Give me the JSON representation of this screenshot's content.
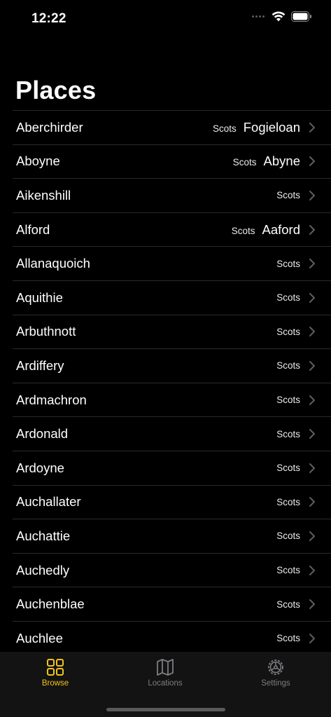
{
  "status_bar": {
    "time": "12:22"
  },
  "title": "Places",
  "places": [
    {
      "name": "Aberchirder",
      "lang": "Scots",
      "translation": "Fogieloan"
    },
    {
      "name": "Aboyne",
      "lang": "Scots",
      "translation": "Abyne"
    },
    {
      "name": "Aikenshill",
      "lang": "Scots",
      "translation": ""
    },
    {
      "name": "Alford",
      "lang": "Scots",
      "translation": "Aaford"
    },
    {
      "name": "Allanaquoich",
      "lang": "Scots",
      "translation": ""
    },
    {
      "name": "Aquithie",
      "lang": "Scots",
      "translation": ""
    },
    {
      "name": "Arbuthnott",
      "lang": "Scots",
      "translation": ""
    },
    {
      "name": "Ardiffery",
      "lang": "Scots",
      "translation": ""
    },
    {
      "name": "Ardmachron",
      "lang": "Scots",
      "translation": ""
    },
    {
      "name": "Ardonald",
      "lang": "Scots",
      "translation": ""
    },
    {
      "name": "Ardoyne",
      "lang": "Scots",
      "translation": ""
    },
    {
      "name": "Auchallater",
      "lang": "Scots",
      "translation": ""
    },
    {
      "name": "Auchattie",
      "lang": "Scots",
      "translation": ""
    },
    {
      "name": "Auchedly",
      "lang": "Scots",
      "translation": ""
    },
    {
      "name": "Auchenblae",
      "lang": "Scots",
      "translation": ""
    },
    {
      "name": "Auchlee",
      "lang": "Scots",
      "translation": ""
    }
  ],
  "tabs": {
    "browse": {
      "label": "Browse",
      "icon": "grid-icon",
      "active": true
    },
    "locations": {
      "label": "Locations",
      "icon": "map-icon"
    },
    "settings": {
      "label": "Settings",
      "icon": "gear-icon"
    }
  },
  "colors": {
    "accent": "#f2c21b",
    "inactive": "#7d7d82",
    "background": "#000000"
  }
}
